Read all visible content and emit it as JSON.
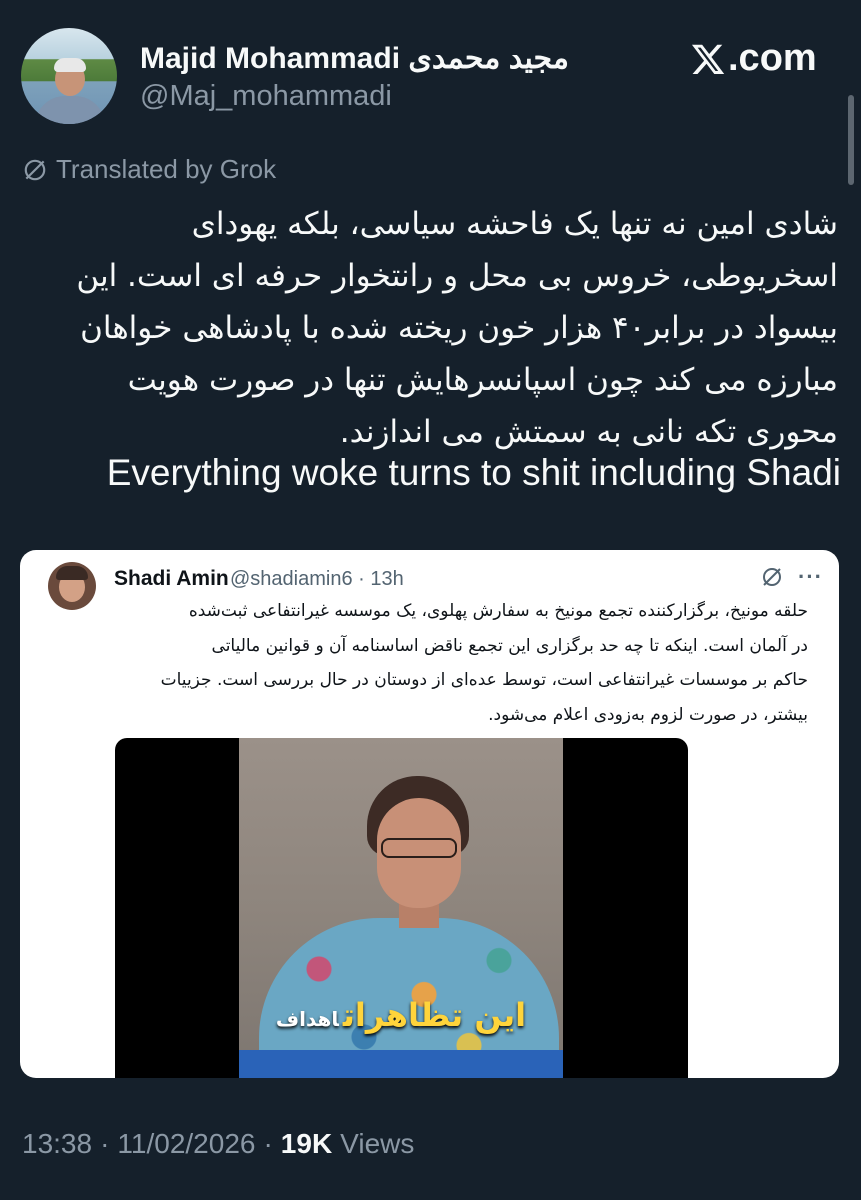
{
  "author": {
    "name": "Majid Mohammadi مجید محمدی",
    "handle": "@Maj_mohammadi",
    "site": ".com"
  },
  "translation": {
    "label": "Translated by Grok"
  },
  "post": {
    "lines": [
      "شادی امین نه تنها یک فاحشه سیاسی، بلکه یهودای",
      "اسخریوطی، خروس بی محل و رانتخوار حرفه ای است. این",
      "بیسواد در برابر۴۰ هزار خون ریخته شده با پادشاهی خواهان",
      "مبارزه می کند چون اسپانسرهایش تنها در صورت هویت",
      "محوری تکه نانی به سمتش می اندازند."
    ],
    "english": "Everything woke turns to shit including Shadi"
  },
  "quoted": {
    "name": "Shadi Amin",
    "handle": "@shadiamin6",
    "separator": "·",
    "time": "13h",
    "more": "···",
    "lines": [
      "حلقه مونیخ، برگزارکننده تجمع مونیخ به سفارش پهلوی، یک موسسه غیرانتفاعی ثبت‌شده",
      "در آلمان است. اینکه تا چه حد برگزاری این تجمع ناقض اساسنامه آن و قوانین مالیاتی",
      "حاکم بر موسسات غیرانتفاعی است، توسط عده‌ای از دوستان در حال بررسی است. جزییات",
      "بیشتر، در صورت لزوم به‌زودی اعلام می‌شود."
    ],
    "video_caption_big": "این تظاهرات",
    "video_caption_small": "اهداف"
  },
  "footer": {
    "time": "13:38",
    "date": "11/02/2026",
    "views_count": "19K",
    "views_label": "Views",
    "separator": "·"
  },
  "colors": {
    "background": "#15202b",
    "text": "#f7f9f9",
    "secondary": "#8b98a5",
    "card": "#ffffff"
  },
  "icons": [
    "x-logo-icon",
    "translate-icon",
    "grok-icon",
    "more-icon"
  ]
}
